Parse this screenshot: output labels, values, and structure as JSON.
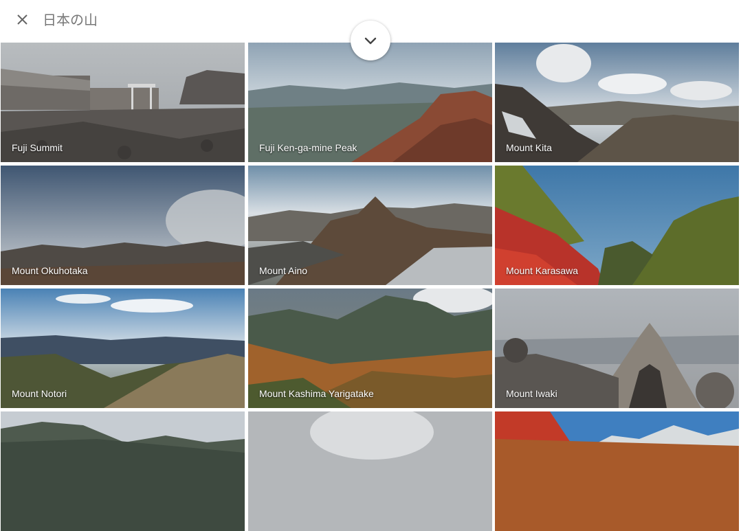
{
  "header": {
    "title": "日本の山"
  },
  "icons": {
    "close": "close-icon",
    "expand": "chevron-down-icon"
  },
  "tiles": [
    {
      "label": "Fuji Summit"
    },
    {
      "label": "Fuji Ken-ga-mine Peak"
    },
    {
      "label": "Mount Kita"
    },
    {
      "label": "Mount Okuhotaka"
    },
    {
      "label": "Mount Aino"
    },
    {
      "label": "Mount Karasawa"
    },
    {
      "label": "Mount Notori"
    },
    {
      "label": "Mount Kashima Yarigatake"
    },
    {
      "label": "Mount Iwaki"
    },
    {
      "label": ""
    },
    {
      "label": ""
    },
    {
      "label": ""
    }
  ]
}
